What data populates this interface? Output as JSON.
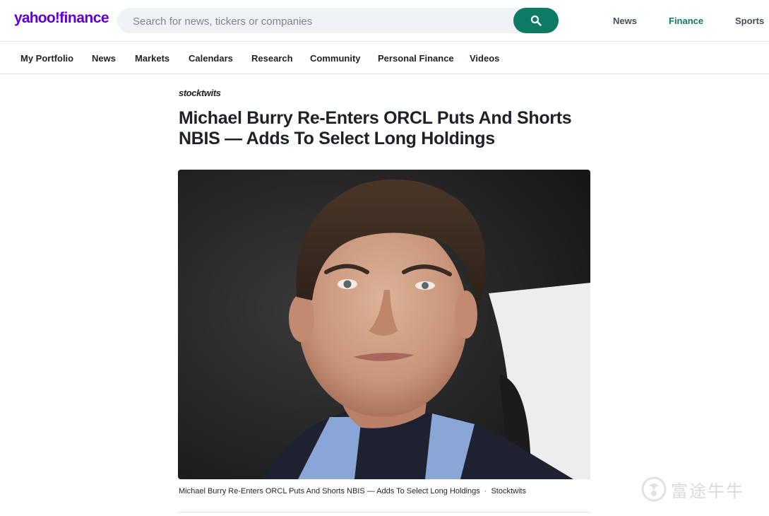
{
  "header": {
    "logo_yahoo": "yahoo",
    "logo_finance": "finance",
    "search_placeholder": "Search for news, tickers or companies",
    "top_links": [
      "News",
      "Finance",
      "Sports"
    ],
    "active_top_link": "Finance",
    "accent_color": "#0d7a63",
    "brand_color": "#6001d2"
  },
  "subnav": {
    "items": [
      "My Portfolio",
      "News",
      "Markets",
      "Calendars",
      "Research",
      "Community",
      "Personal Finance",
      "Videos"
    ]
  },
  "article": {
    "provider": "stocktwits",
    "headline": "Michael Burry Re-Enters ORCL Puts And Shorts NBIS — Adds To Select Long Holdings",
    "image_icon": "portrait-photo",
    "caption": "Michael Burry Re-Enters ORCL Puts And Shorts NBIS — Adds To Select Long Holdings",
    "caption_separator": "·",
    "caption_credit": "Stocktwits"
  },
  "watermark": {
    "text": "富途牛牛",
    "icon": "futu-logo-icon"
  }
}
